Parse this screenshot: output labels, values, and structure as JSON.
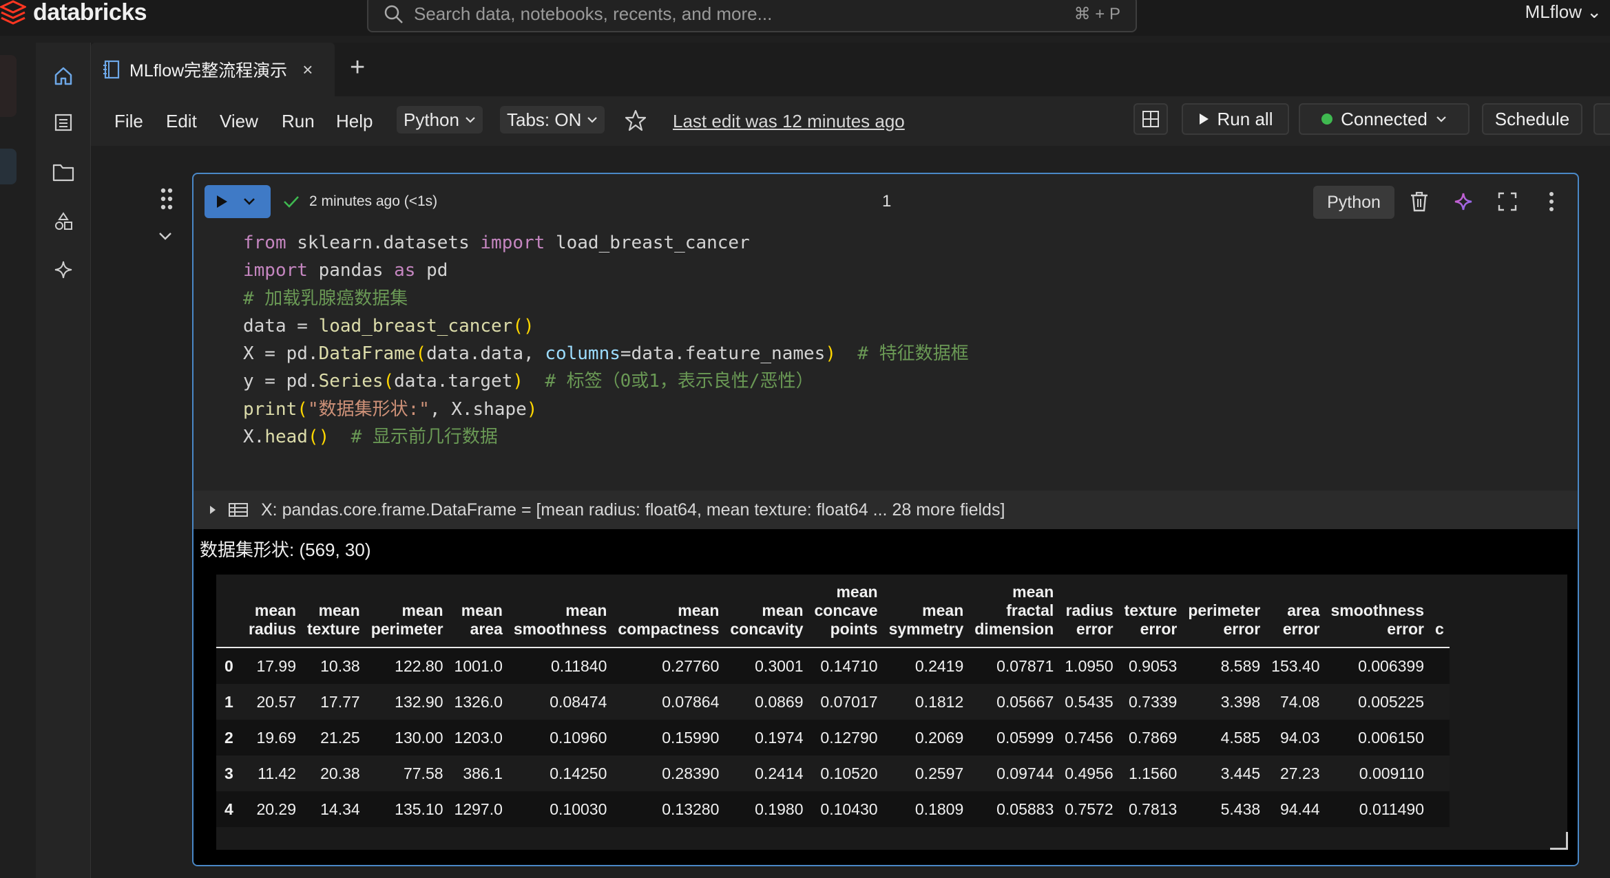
{
  "app": {
    "brand": "databricks",
    "workspace": "MLflow"
  },
  "search": {
    "placeholder": "Search data, notebooks, recents, and more...",
    "shortcut": "⌘ + P"
  },
  "tabs": [
    {
      "label": "MLflow完整流程演示",
      "close": "×"
    }
  ],
  "toolbar": {
    "menus": [
      "File",
      "Edit",
      "View",
      "Run",
      "Help"
    ],
    "language": "Python",
    "tabs_setting": "Tabs: ON",
    "last_edit": "Last edit was 12 minutes ago",
    "run_all": "Run all",
    "connection": "Connected",
    "schedule": "Schedule"
  },
  "colors": {
    "accent": "#3f7ac6",
    "cell_border": "#4a88c7",
    "connected": "#3fb950",
    "success": "#3fb950"
  },
  "cell": {
    "status": "2 minutes ago (<1s)",
    "number": "1",
    "language": "Python",
    "code_lines": [
      "from sklearn.datasets import load_breast_cancer",
      "import pandas as pd",
      "# 加载乳腺癌数据集",
      "data = load_breast_cancer()",
      "X = pd.DataFrame(data.data, columns=data.feature_names)  # 特征数据框",
      "y = pd.Series(data.target)  # 标签（0或1，表示良性/恶性）",
      "print(\"数据集形状:\", X.shape)",
      "X.head()  # 显示前几行数据"
    ],
    "variable_summary": "X:  pandas.core.frame.DataFrame = [mean radius: float64, mean texture: float64 ... 28 more fields]",
    "printed": "数据集形状: (569, 30)",
    "table": {
      "columns": [
        [
          "mean",
          "radius"
        ],
        [
          "mean",
          "texture"
        ],
        [
          "mean",
          "perimeter"
        ],
        [
          "mean",
          "area"
        ],
        [
          "mean",
          "smoothness"
        ],
        [
          "mean",
          "compactness"
        ],
        [
          "mean",
          "concavity"
        ],
        [
          "mean",
          "concave",
          "points"
        ],
        [
          "mean",
          "symmetry"
        ],
        [
          "mean",
          "fractal",
          "dimension"
        ],
        [
          "radius",
          "error"
        ],
        [
          "texture",
          "error"
        ],
        [
          "perimeter",
          "error"
        ],
        [
          "area",
          "error"
        ],
        [
          "smoothness",
          "error"
        ],
        [
          "c"
        ]
      ],
      "rows": [
        {
          "index": "0",
          "values": [
            "17.99",
            "10.38",
            "122.80",
            "1001.0",
            "0.11840",
            "0.27760",
            "0.3001",
            "0.14710",
            "0.2419",
            "0.07871",
            "1.0950",
            "0.9053",
            "8.589",
            "153.40",
            "0.006399"
          ]
        },
        {
          "index": "1",
          "values": [
            "20.57",
            "17.77",
            "132.90",
            "1326.0",
            "0.08474",
            "0.07864",
            "0.0869",
            "0.07017",
            "0.1812",
            "0.05667",
            "0.5435",
            "0.7339",
            "3.398",
            "74.08",
            "0.005225"
          ]
        },
        {
          "index": "2",
          "values": [
            "19.69",
            "21.25",
            "130.00",
            "1203.0",
            "0.10960",
            "0.15990",
            "0.1974",
            "0.12790",
            "0.2069",
            "0.05999",
            "0.7456",
            "0.7869",
            "4.585",
            "94.03",
            "0.006150"
          ]
        },
        {
          "index": "3",
          "values": [
            "11.42",
            "20.38",
            "77.58",
            "386.1",
            "0.14250",
            "0.28390",
            "0.2414",
            "0.10520",
            "0.2597",
            "0.09744",
            "0.4956",
            "1.1560",
            "3.445",
            "27.23",
            "0.009110"
          ]
        },
        {
          "index": "4",
          "values": [
            "20.29",
            "14.34",
            "135.10",
            "1297.0",
            "0.10030",
            "0.13280",
            "0.1980",
            "0.10430",
            "0.1809",
            "0.05883",
            "0.7572",
            "0.7813",
            "5.438",
            "94.44",
            "0.011490"
          ]
        }
      ]
    }
  },
  "icons": [
    "databricks-logo-icon",
    "search-icon",
    "home-icon",
    "notebook-icon",
    "run-icon",
    "chevron-down-icon",
    "star-icon",
    "layout-icon",
    "play-icon",
    "check-icon",
    "trash-icon",
    "assistant-sparkle-icon",
    "fullscreen-icon",
    "more-vertical-icon",
    "drag-handle-icon",
    "table-icon",
    "resize-handle-icon"
  ]
}
